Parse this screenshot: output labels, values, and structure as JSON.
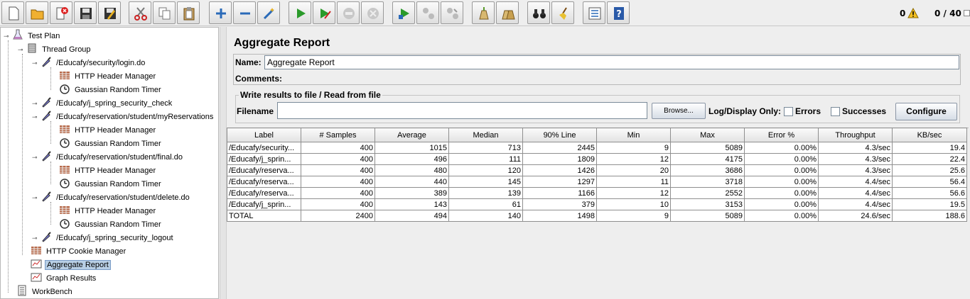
{
  "toolbar": {
    "buttons": [
      {
        "name": "new-button",
        "icon": "new-file-icon"
      },
      {
        "name": "templates-button",
        "icon": "folder-open-icon"
      },
      {
        "name": "open-button",
        "icon": "open-icon"
      },
      {
        "name": "close-button",
        "icon": "close-doc-icon"
      },
      {
        "name": "save-button",
        "icon": "save-icon"
      },
      {
        "name": "save-as-button",
        "icon": "save-as-icon"
      },
      {
        "name": "cut-button",
        "icon": "cut-icon"
      },
      {
        "name": "copy-button",
        "icon": "copy-icon"
      },
      {
        "name": "paste-button",
        "icon": "paste-icon"
      },
      {
        "name": "expand-button",
        "icon": "plus-icon"
      },
      {
        "name": "collapse-button",
        "icon": "minus-icon"
      },
      {
        "name": "toggle-button",
        "icon": "wand-icon"
      },
      {
        "name": "start-button",
        "icon": "play-icon"
      },
      {
        "name": "start-no-pause-button",
        "icon": "play-no-pause-icon"
      },
      {
        "name": "stop-button",
        "icon": "stop-icon"
      },
      {
        "name": "shutdown-button",
        "icon": "shutdown-icon"
      },
      {
        "name": "remote-start-button",
        "icon": "remote-start-icon"
      },
      {
        "name": "remote-stop-button",
        "icon": "remote-stop-icon"
      },
      {
        "name": "remote-shutdown-button",
        "icon": "remote-shutdown-icon"
      },
      {
        "name": "clear-button",
        "icon": "clear-icon"
      },
      {
        "name": "clear-all-button",
        "icon": "clear-all-icon"
      },
      {
        "name": "search-button",
        "icon": "binoculars-icon"
      },
      {
        "name": "reset-search-button",
        "icon": "broom-icon"
      },
      {
        "name": "function-helper-button",
        "icon": "list-icon"
      },
      {
        "name": "help-button",
        "icon": "help-icon"
      }
    ],
    "error_count": "0",
    "thread_count": "0 / 40"
  },
  "tree": {
    "items": [
      {
        "label": "Test Plan",
        "icon": "flask-icon"
      },
      {
        "label": "Thread Group",
        "icon": "spool-icon"
      },
      {
        "label": "/Educafy/security/login.do",
        "icon": "pipette-icon"
      },
      {
        "label": "HTTP Header Manager",
        "icon": "header-manager-icon"
      },
      {
        "label": "Gaussian Random Timer",
        "icon": "timer-icon"
      },
      {
        "label": "/Educafy/j_spring_security_check",
        "icon": "pipette-icon"
      },
      {
        "label": "/Educafy/reservation/student/myReservations",
        "icon": "pipette-icon"
      },
      {
        "label": "HTTP Header Manager",
        "icon": "header-manager-icon"
      },
      {
        "label": "Gaussian Random Timer",
        "icon": "timer-icon"
      },
      {
        "label": "/Educafy/reservation/student/final.do",
        "icon": "pipette-icon"
      },
      {
        "label": "HTTP Header Manager",
        "icon": "header-manager-icon"
      },
      {
        "label": "Gaussian Random Timer",
        "icon": "timer-icon"
      },
      {
        "label": "/Educafy/reservation/student/delete.do",
        "icon": "pipette-icon"
      },
      {
        "label": "HTTP Header Manager",
        "icon": "header-manager-icon"
      },
      {
        "label": "Gaussian Random Timer",
        "icon": "timer-icon"
      },
      {
        "label": "/Educafy/j_spring_security_logout",
        "icon": "pipette-icon"
      },
      {
        "label": "HTTP Cookie Manager",
        "icon": "cookie-manager-icon"
      },
      {
        "label": "Aggregate Report",
        "icon": "report-icon"
      },
      {
        "label": "Graph Results",
        "icon": "report-icon"
      },
      {
        "label": "WorkBench",
        "icon": "workbench-icon"
      }
    ]
  },
  "panel": {
    "title": "Aggregate Report",
    "name_label": "Name:",
    "name_value": "Aggregate Report",
    "comments_label": "Comments:",
    "file_group_title": "Write results to file / Read from file",
    "filename_label": "Filename",
    "filename_value": "",
    "browse_label": "Browse...",
    "log_display_label": "Log/Display Only:",
    "errors_label": "Errors",
    "successes_label": "Successes",
    "configure_label": "Configure"
  },
  "table": {
    "columns": [
      "Label",
      "# Samples",
      "Average",
      "Median",
      "90% Line",
      "Min",
      "Max",
      "Error %",
      "Throughput",
      "KB/sec"
    ],
    "rows": [
      [
        "/Educafy/security...",
        "400",
        "1015",
        "713",
        "2445",
        "9",
        "5089",
        "0.00%",
        "4.3/sec",
        "19.4"
      ],
      [
        "/Educafy/j_sprin...",
        "400",
        "496",
        "111",
        "1809",
        "12",
        "4175",
        "0.00%",
        "4.3/sec",
        "22.4"
      ],
      [
        "/Educafy/reserva...",
        "400",
        "480",
        "120",
        "1426",
        "20",
        "3686",
        "0.00%",
        "4.3/sec",
        "25.6"
      ],
      [
        "/Educafy/reserva...",
        "400",
        "440",
        "145",
        "1297",
        "11",
        "3718",
        "0.00%",
        "4.4/sec",
        "56.4"
      ],
      [
        "/Educafy/reserva...",
        "400",
        "389",
        "139",
        "1166",
        "12",
        "2552",
        "0.00%",
        "4.4/sec",
        "56.6"
      ],
      [
        "/Educafy/j_sprin...",
        "400",
        "143",
        "61",
        "379",
        "10",
        "3153",
        "0.00%",
        "4.4/sec",
        "19.5"
      ],
      [
        "TOTAL",
        "2400",
        "494",
        "140",
        "1498",
        "9",
        "5089",
        "0.00%",
        "24.6/sec",
        "188.6"
      ]
    ]
  }
}
